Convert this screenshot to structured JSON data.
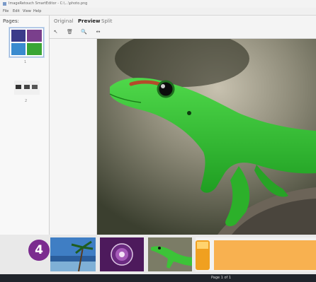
{
  "window": {
    "title": "ImageRetouch SmartEditor - C:\\...\\photo.png"
  },
  "menu": {
    "items": [
      "File",
      "Edit",
      "View",
      "Help"
    ]
  },
  "pages_panel": {
    "label": "Pages:",
    "page_numbers": [
      "1",
      "2"
    ]
  },
  "tabs": [
    "Original",
    "Preview",
    "Split"
  ],
  "active_tab": "Preview",
  "toolbar": {
    "icons": [
      "pointer-icon",
      "delete-icon",
      "zoom-icon",
      "pan-icon"
    ]
  },
  "badge": {
    "number": "4"
  },
  "status": {
    "page": "Page 1 of 1"
  },
  "colors": {
    "accent": "#7b2c8f",
    "gecko_green": "#2fbf2c",
    "status_bar": "#20242b"
  }
}
